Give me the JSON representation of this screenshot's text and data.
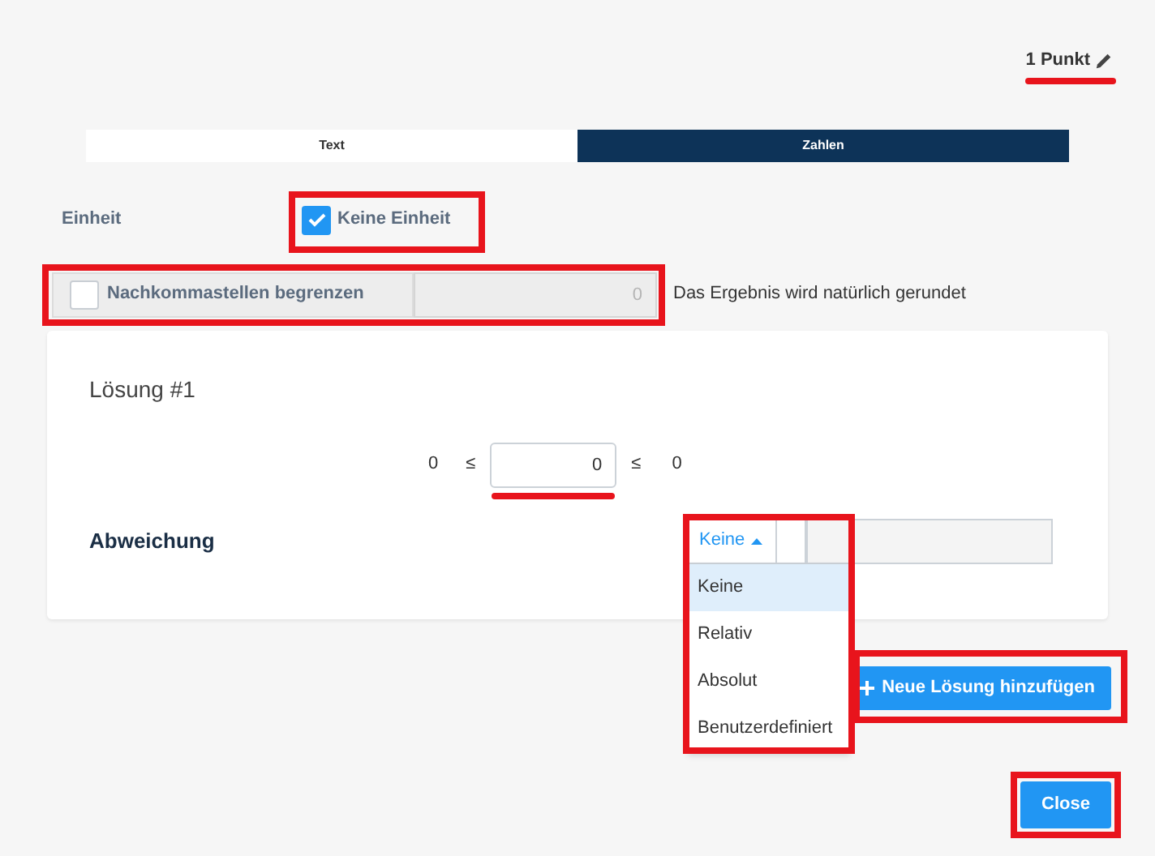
{
  "points": {
    "label": "1 Punkt",
    "highlighted": true
  },
  "tabs": [
    {
      "label": "Text",
      "selected": false
    },
    {
      "label": "Zahlen",
      "selected": true
    }
  ],
  "unit": {
    "label": "Einheit",
    "option": {
      "label": "Keine Einheit",
      "checked": true,
      "highlighted": true
    }
  },
  "decimals": {
    "label": "Nachkommastellen begrenzen",
    "checked": false,
    "value": "0",
    "disabled": true,
    "highlighted": true,
    "note": "Das Ergebnis wird natürlich gerundet"
  },
  "solution": {
    "title": "Lösung #1",
    "lower": "0",
    "lower_sign": "≤",
    "value": "0",
    "value_highlighted": true,
    "upper_sign": "≤",
    "upper": "0",
    "deviation": {
      "label": "Abweichung",
      "value": "Keine",
      "expanded": true,
      "highlighted": true,
      "options": [
        {
          "label": "Keine",
          "selected": true
        },
        {
          "label": "Relativ",
          "selected": false
        },
        {
          "label": "Absolut",
          "selected": false
        },
        {
          "label": "Benutzerdefiniert",
          "selected": false
        }
      ]
    }
  },
  "buttons": [
    {
      "label": "Neue Lösung hinzufügen",
      "kind": "add",
      "highlighted": true
    },
    {
      "label": "Close",
      "kind": "close",
      "highlighted": true
    }
  ]
}
